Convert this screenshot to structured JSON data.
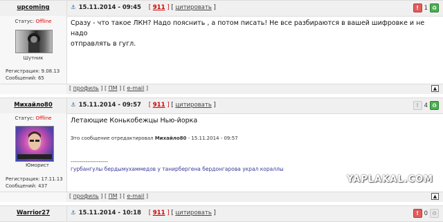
{
  "posts": [
    {
      "user": "upcoming",
      "date": "15.11.2014 - 09:45",
      "post_num": "911",
      "quote_label": "цитировать",
      "status_label": "Статус:",
      "status_value": "Offline",
      "rank": "Шутник",
      "reg_label": "Регистрация:",
      "reg_date": "9.08.13",
      "msgs_label": "Сообщений:",
      "msgs": "65",
      "text_line1": "Сразу - что такое ЛКН? Надо пояснить , а потом писать! Не все разбираются в вашей шифровке и не надо",
      "text_line2": "отправлять в гугл.",
      "votes": "1"
    },
    {
      "user": "Михайло80",
      "date": "15.11.2014 - 09:57",
      "post_num": "911",
      "quote_label": "цитировать",
      "status_label": "Статус:",
      "status_value": "Offline",
      "rank": "Юморист",
      "reg_label": "Регистрация:",
      "reg_date": "17.11.13",
      "msgs_label": "Сообщений:",
      "msgs": "437",
      "text_line1": "Летающие Конькобежцы Нью-йорка",
      "edit_prefix": "Это сообщение отредактировал",
      "edit_user": "Михайло80",
      "edit_date": " - 15.11.2014 - 09:57",
      "sig_line1": "--------------------",
      "sig_line2": "гурбангулы бердымухаммедов у танирбергена бердонгарова украл кораллы",
      "votes": "4"
    },
    {
      "user": "Warrior27",
      "date": "15.11.2014 - 10:18",
      "post_num": "911",
      "quote_label": "цитировать",
      "votes": "0"
    }
  ],
  "footer": {
    "profile": "профиль",
    "pm": "ПМ",
    "email": "e-mail"
  },
  "watermark": "YAPLAKAL.COM",
  "colors": {
    "offline": "#dd0000",
    "post_num": "#cc0000",
    "minus": "#e25c5c",
    "plus": "#4caf50"
  }
}
